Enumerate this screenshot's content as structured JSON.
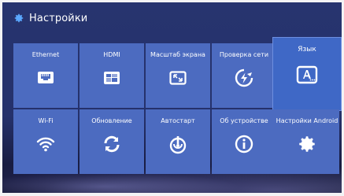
{
  "header": {
    "title": "Настройки",
    "icon": "gear-icon"
  },
  "tiles": [
    {
      "label": "Ethernet",
      "icon": "ethernet-icon"
    },
    {
      "label": "HDMI",
      "icon": "hdmi-icon"
    },
    {
      "label": "Масштаб экрана",
      "icon": "screen-scale-icon"
    },
    {
      "label": "Проверка сети",
      "icon": "network-check-icon"
    },
    {
      "label": "Язык",
      "icon": "language-icon",
      "selected": true
    },
    {
      "label": "Wi-Fi",
      "icon": "wifi-icon"
    },
    {
      "label": "Обновление",
      "icon": "refresh-icon"
    },
    {
      "label": "Автостарт",
      "icon": "autostart-icon"
    },
    {
      "label": "Об устройстве",
      "icon": "info-icon"
    },
    {
      "label": "Настройки Android",
      "icon": "gear-icon"
    }
  ],
  "colors": {
    "tile": "#4c6bc0",
    "background": "#27346f"
  }
}
